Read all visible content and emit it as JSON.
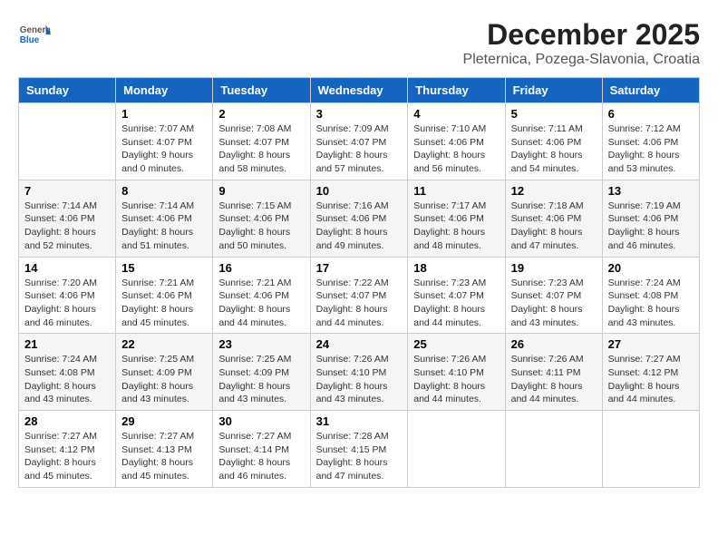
{
  "header": {
    "logo_general": "General",
    "logo_blue": "Blue",
    "month_title": "December 2025",
    "location": "Pleternica, Pozega-Slavonia, Croatia"
  },
  "days_of_week": [
    "Sunday",
    "Monday",
    "Tuesday",
    "Wednesday",
    "Thursday",
    "Friday",
    "Saturday"
  ],
  "weeks": [
    [
      {
        "day": "",
        "sunrise": "",
        "sunset": "",
        "daylight": ""
      },
      {
        "day": "1",
        "sunrise": "Sunrise: 7:07 AM",
        "sunset": "Sunset: 4:07 PM",
        "daylight": "Daylight: 9 hours and 0 minutes."
      },
      {
        "day": "2",
        "sunrise": "Sunrise: 7:08 AM",
        "sunset": "Sunset: 4:07 PM",
        "daylight": "Daylight: 8 hours and 58 minutes."
      },
      {
        "day": "3",
        "sunrise": "Sunrise: 7:09 AM",
        "sunset": "Sunset: 4:07 PM",
        "daylight": "Daylight: 8 hours and 57 minutes."
      },
      {
        "day": "4",
        "sunrise": "Sunrise: 7:10 AM",
        "sunset": "Sunset: 4:06 PM",
        "daylight": "Daylight: 8 hours and 56 minutes."
      },
      {
        "day": "5",
        "sunrise": "Sunrise: 7:11 AM",
        "sunset": "Sunset: 4:06 PM",
        "daylight": "Daylight: 8 hours and 54 minutes."
      },
      {
        "day": "6",
        "sunrise": "Sunrise: 7:12 AM",
        "sunset": "Sunset: 4:06 PM",
        "daylight": "Daylight: 8 hours and 53 minutes."
      }
    ],
    [
      {
        "day": "7",
        "sunrise": "Sunrise: 7:14 AM",
        "sunset": "Sunset: 4:06 PM",
        "daylight": "Daylight: 8 hours and 52 minutes."
      },
      {
        "day": "8",
        "sunrise": "Sunrise: 7:14 AM",
        "sunset": "Sunset: 4:06 PM",
        "daylight": "Daylight: 8 hours and 51 minutes."
      },
      {
        "day": "9",
        "sunrise": "Sunrise: 7:15 AM",
        "sunset": "Sunset: 4:06 PM",
        "daylight": "Daylight: 8 hours and 50 minutes."
      },
      {
        "day": "10",
        "sunrise": "Sunrise: 7:16 AM",
        "sunset": "Sunset: 4:06 PM",
        "daylight": "Daylight: 8 hours and 49 minutes."
      },
      {
        "day": "11",
        "sunrise": "Sunrise: 7:17 AM",
        "sunset": "Sunset: 4:06 PM",
        "daylight": "Daylight: 8 hours and 48 minutes."
      },
      {
        "day": "12",
        "sunrise": "Sunrise: 7:18 AM",
        "sunset": "Sunset: 4:06 PM",
        "daylight": "Daylight: 8 hours and 47 minutes."
      },
      {
        "day": "13",
        "sunrise": "Sunrise: 7:19 AM",
        "sunset": "Sunset: 4:06 PM",
        "daylight": "Daylight: 8 hours and 46 minutes."
      }
    ],
    [
      {
        "day": "14",
        "sunrise": "Sunrise: 7:20 AM",
        "sunset": "Sunset: 4:06 PM",
        "daylight": "Daylight: 8 hours and 46 minutes."
      },
      {
        "day": "15",
        "sunrise": "Sunrise: 7:21 AM",
        "sunset": "Sunset: 4:06 PM",
        "daylight": "Daylight: 8 hours and 45 minutes."
      },
      {
        "day": "16",
        "sunrise": "Sunrise: 7:21 AM",
        "sunset": "Sunset: 4:06 PM",
        "daylight": "Daylight: 8 hours and 44 minutes."
      },
      {
        "day": "17",
        "sunrise": "Sunrise: 7:22 AM",
        "sunset": "Sunset: 4:07 PM",
        "daylight": "Daylight: 8 hours and 44 minutes."
      },
      {
        "day": "18",
        "sunrise": "Sunrise: 7:23 AM",
        "sunset": "Sunset: 4:07 PM",
        "daylight": "Daylight: 8 hours and 44 minutes."
      },
      {
        "day": "19",
        "sunrise": "Sunrise: 7:23 AM",
        "sunset": "Sunset: 4:07 PM",
        "daylight": "Daylight: 8 hours and 43 minutes."
      },
      {
        "day": "20",
        "sunrise": "Sunrise: 7:24 AM",
        "sunset": "Sunset: 4:08 PM",
        "daylight": "Daylight: 8 hours and 43 minutes."
      }
    ],
    [
      {
        "day": "21",
        "sunrise": "Sunrise: 7:24 AM",
        "sunset": "Sunset: 4:08 PM",
        "daylight": "Daylight: 8 hours and 43 minutes."
      },
      {
        "day": "22",
        "sunrise": "Sunrise: 7:25 AM",
        "sunset": "Sunset: 4:09 PM",
        "daylight": "Daylight: 8 hours and 43 minutes."
      },
      {
        "day": "23",
        "sunrise": "Sunrise: 7:25 AM",
        "sunset": "Sunset: 4:09 PM",
        "daylight": "Daylight: 8 hours and 43 minutes."
      },
      {
        "day": "24",
        "sunrise": "Sunrise: 7:26 AM",
        "sunset": "Sunset: 4:10 PM",
        "daylight": "Daylight: 8 hours and 43 minutes."
      },
      {
        "day": "25",
        "sunrise": "Sunrise: 7:26 AM",
        "sunset": "Sunset: 4:10 PM",
        "daylight": "Daylight: 8 hours and 44 minutes."
      },
      {
        "day": "26",
        "sunrise": "Sunrise: 7:26 AM",
        "sunset": "Sunset: 4:11 PM",
        "daylight": "Daylight: 8 hours and 44 minutes."
      },
      {
        "day": "27",
        "sunrise": "Sunrise: 7:27 AM",
        "sunset": "Sunset: 4:12 PM",
        "daylight": "Daylight: 8 hours and 44 minutes."
      }
    ],
    [
      {
        "day": "28",
        "sunrise": "Sunrise: 7:27 AM",
        "sunset": "Sunset: 4:12 PM",
        "daylight": "Daylight: 8 hours and 45 minutes."
      },
      {
        "day": "29",
        "sunrise": "Sunrise: 7:27 AM",
        "sunset": "Sunset: 4:13 PM",
        "daylight": "Daylight: 8 hours and 45 minutes."
      },
      {
        "day": "30",
        "sunrise": "Sunrise: 7:27 AM",
        "sunset": "Sunset: 4:14 PM",
        "daylight": "Daylight: 8 hours and 46 minutes."
      },
      {
        "day": "31",
        "sunrise": "Sunrise: 7:28 AM",
        "sunset": "Sunset: 4:15 PM",
        "daylight": "Daylight: 8 hours and 47 minutes."
      },
      {
        "day": "",
        "sunrise": "",
        "sunset": "",
        "daylight": ""
      },
      {
        "day": "",
        "sunrise": "",
        "sunset": "",
        "daylight": ""
      },
      {
        "day": "",
        "sunrise": "",
        "sunset": "",
        "daylight": ""
      }
    ]
  ]
}
